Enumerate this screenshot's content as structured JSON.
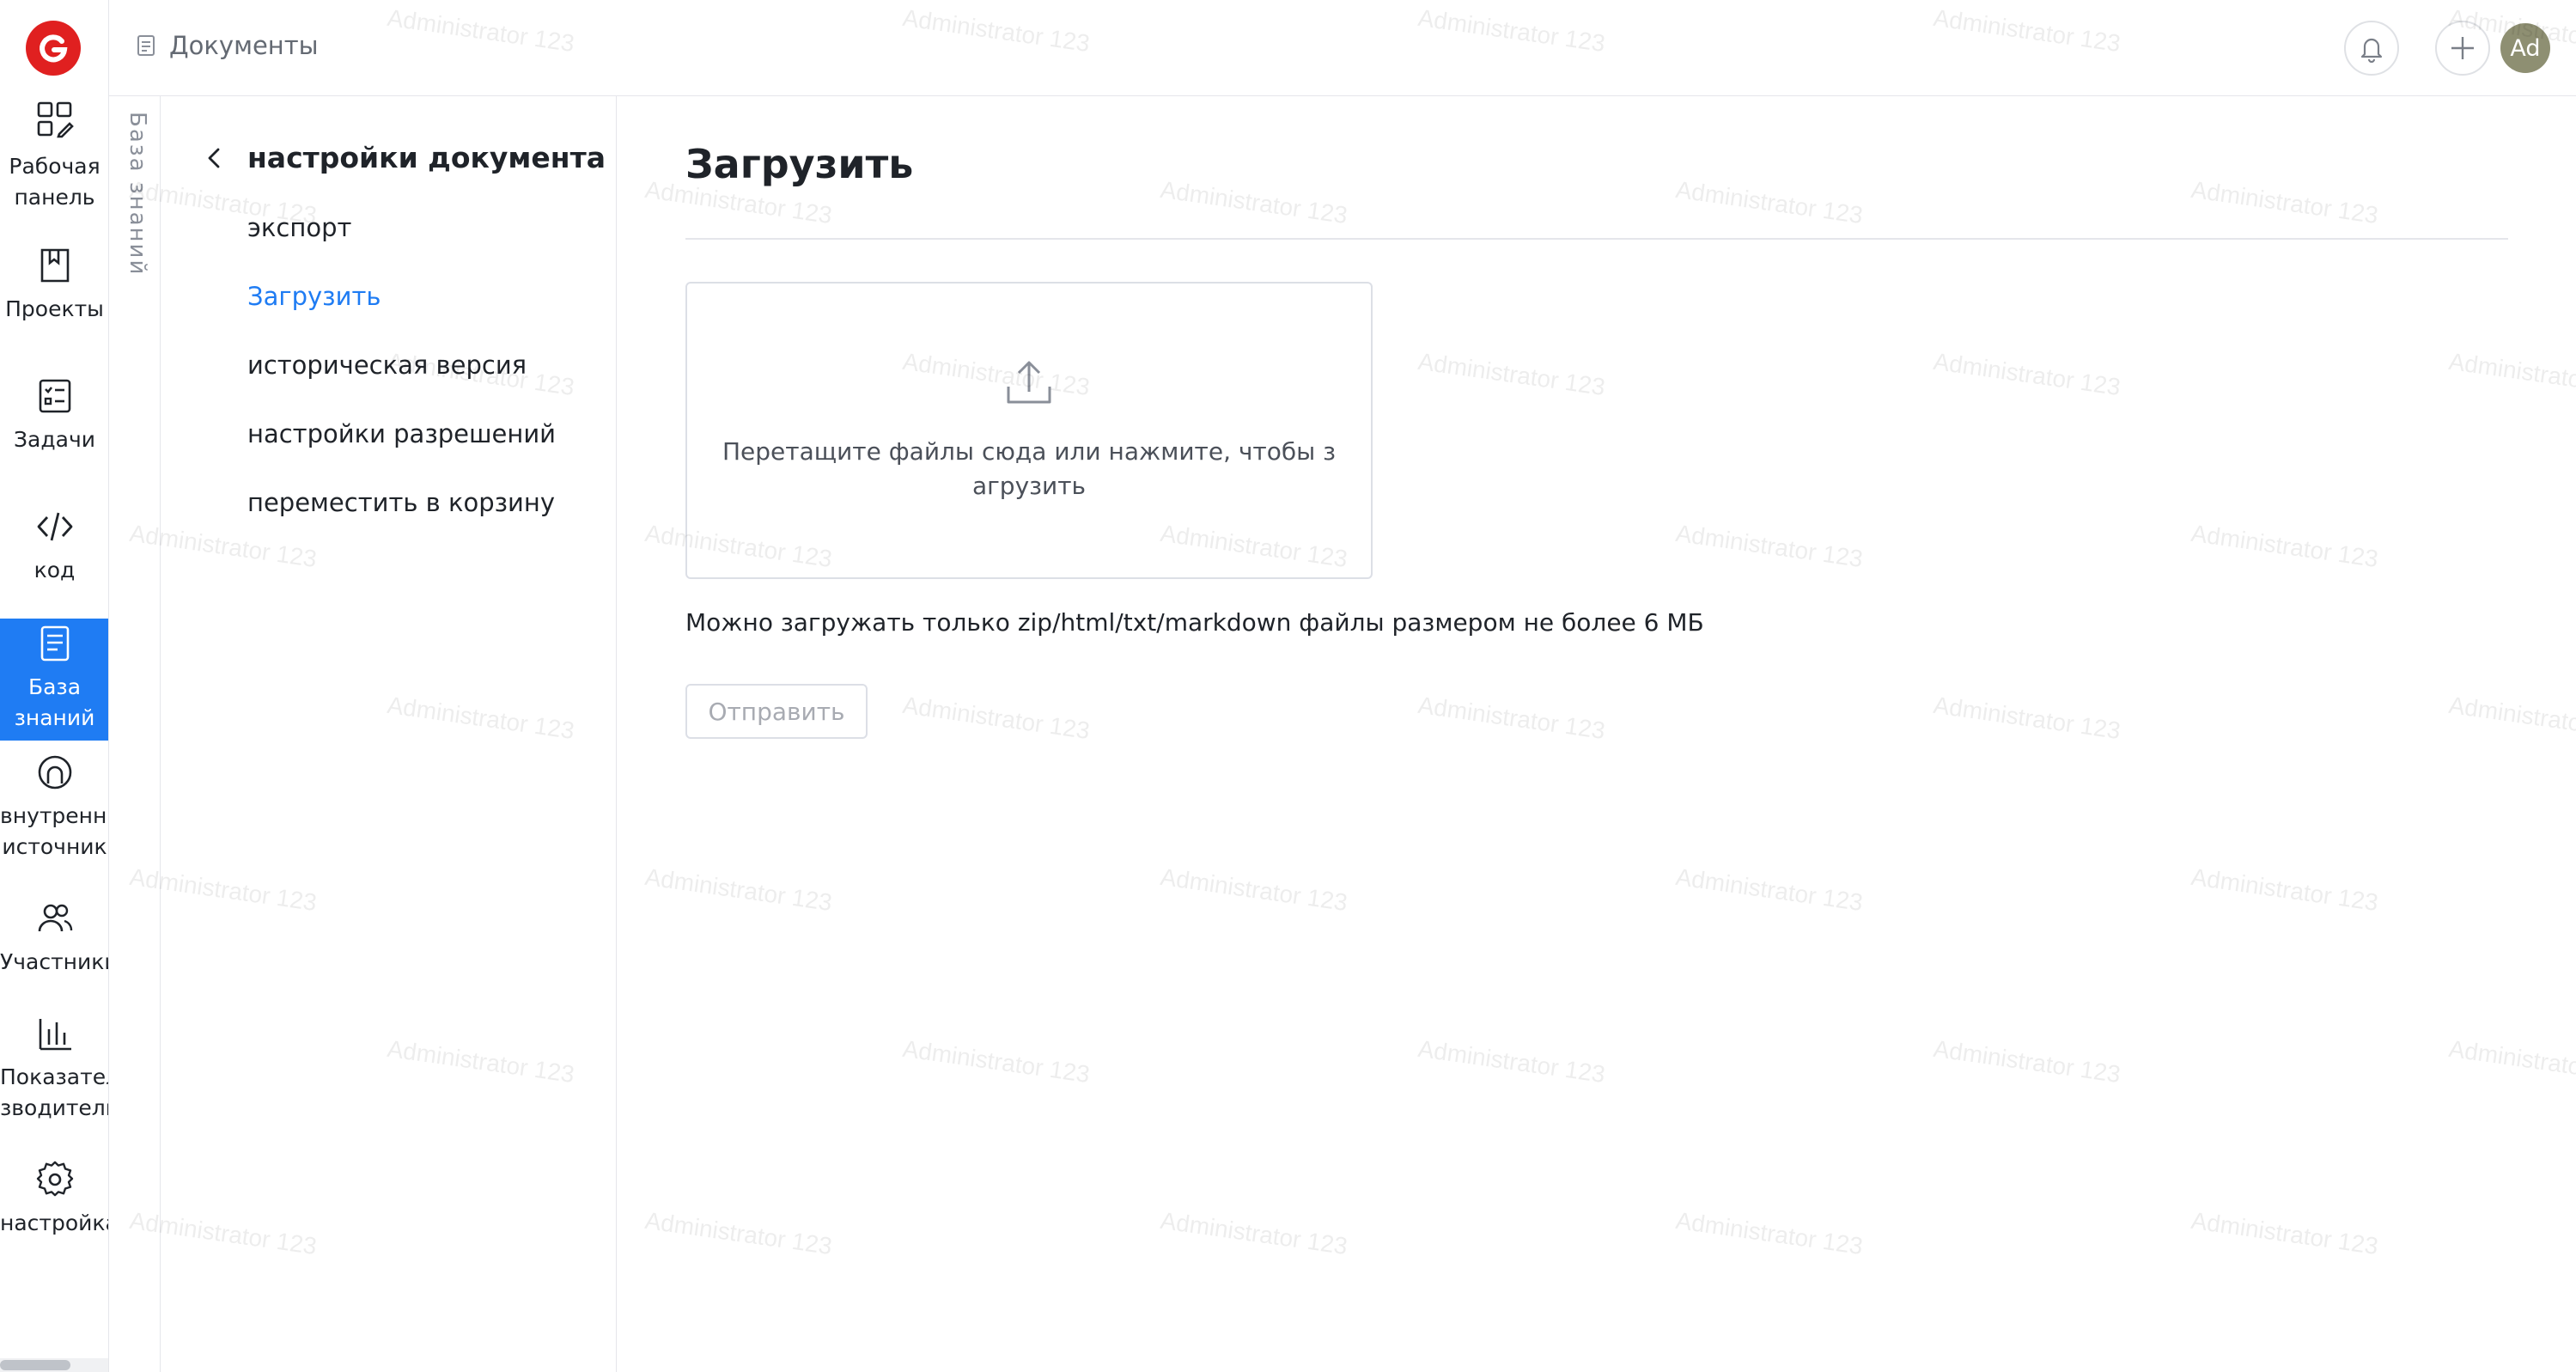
{
  "header": {
    "breadcrumb_label": "Документы",
    "avatar_initials": "Ad"
  },
  "rail": {
    "items": [
      {
        "label_line1": "Рабочая",
        "label_line2": "панель",
        "icon": "dashboard-icon"
      },
      {
        "label_line1": "Проекты",
        "icon": "book-icon"
      },
      {
        "label_line1": "Задачи",
        "icon": "checklist-icon"
      },
      {
        "label_line1": "код",
        "icon": "code-icon"
      },
      {
        "label_line1": "База",
        "label_line2": "знаний",
        "icon": "document-icon"
      },
      {
        "label_line1": "внутренни",
        "label_line2": "источник",
        "icon": "internal-source-icon"
      },
      {
        "label_line1": "Участники",
        "icon": "users-icon"
      },
      {
        "label_line1": "Показател",
        "label_line2": "зводитель",
        "icon": "bar-chart-icon"
      },
      {
        "label_line1": "настройка",
        "icon": "gear-icon"
      }
    ],
    "active_index": 4
  },
  "vertical_panel": {
    "label": "База знаний"
  },
  "settings_panel": {
    "title": "настройки документа",
    "items": [
      {
        "label": "экспорт"
      },
      {
        "label": "Загрузить"
      },
      {
        "label": "историческая версия"
      },
      {
        "label": "настройки разрешений"
      },
      {
        "label": "переместить в корзину"
      }
    ],
    "active_index": 1
  },
  "main": {
    "title": "Загрузить",
    "dropzone_text": "Перетащите файлы сюда или нажмите, чтобы з агрузить",
    "hint": "Можно загружать только zip/html/txt/markdown файлы размером не более 6 МБ",
    "submit_label": "Отправить"
  },
  "watermark": {
    "text": "Administrator 123"
  },
  "colors": {
    "accent": "#1f7cf3",
    "logo": "#e02020",
    "avatar": "#8e8f72"
  }
}
